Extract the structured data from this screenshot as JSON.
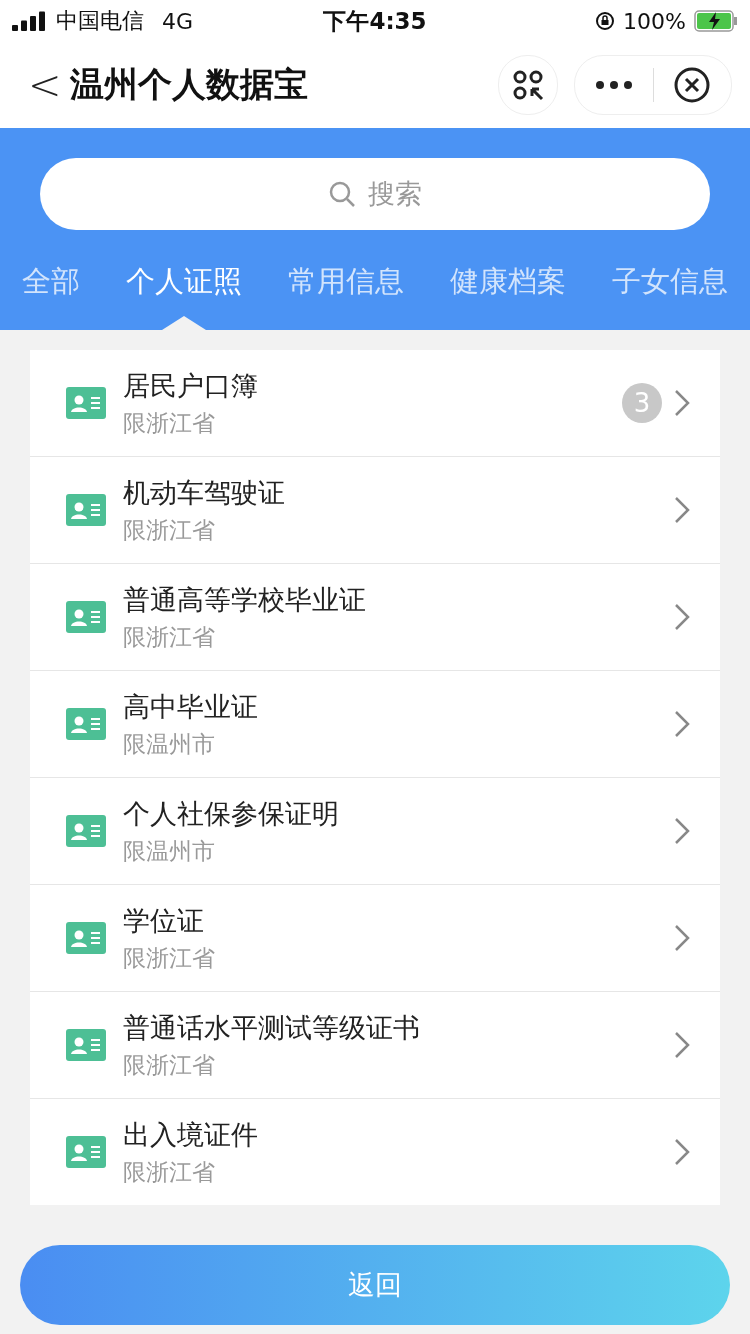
{
  "status_bar": {
    "carrier": "中国电信",
    "network": "4G",
    "time": "下午4:35",
    "battery": "100%"
  },
  "nav": {
    "back": "<",
    "title": "温州个人数据宝"
  },
  "search": {
    "placeholder": "搜索"
  },
  "tabs": [
    {
      "label": "全部",
      "selected": false
    },
    {
      "label": "个人证照",
      "selected": true
    },
    {
      "label": "常用信息",
      "selected": false
    },
    {
      "label": "健康档案",
      "selected": false
    },
    {
      "label": "子女信息",
      "selected": false
    }
  ],
  "items": [
    {
      "title": "居民户口簿",
      "scope": "限浙江省",
      "badge": "3"
    },
    {
      "title": "机动车驾驶证",
      "scope": "限浙江省"
    },
    {
      "title": "普通高等学校毕业证",
      "scope": "限浙江省"
    },
    {
      "title": "高中毕业证",
      "scope": "限温州市"
    },
    {
      "title": "个人社保参保证明",
      "scope": "限温州市"
    },
    {
      "title": "学位证",
      "scope": "限浙江省"
    },
    {
      "title": "普通话水平测试等级证书",
      "scope": "限浙江省"
    },
    {
      "title": "出入境证件",
      "scope": "限浙江省"
    }
  ],
  "return_button": "返回"
}
